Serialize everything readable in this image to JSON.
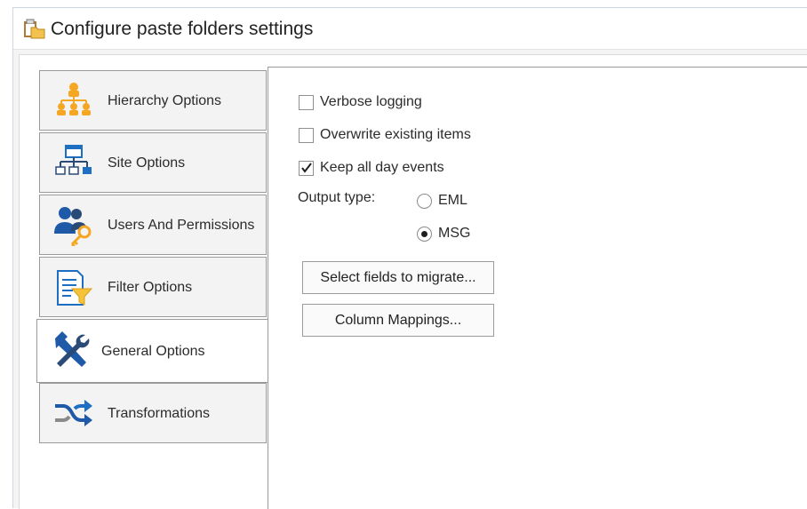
{
  "window": {
    "title": "Configure paste folders settings",
    "icon": "clipboard-folder-icon"
  },
  "tabs": [
    {
      "label": "Hierarchy Options",
      "icon": "hierarchy-icon"
    },
    {
      "label": "Site Options",
      "icon": "site-icon"
    },
    {
      "label": "Users And Permissions",
      "icon": "users-key-icon"
    },
    {
      "label": "Filter Options",
      "icon": "filter-icon"
    },
    {
      "label": "General Options",
      "icon": "tools-icon",
      "active": true
    },
    {
      "label": "Transformations",
      "icon": "shuffle-icon"
    }
  ],
  "general": {
    "verbose_logging": {
      "label": "Verbose logging",
      "checked": false
    },
    "overwrite_items": {
      "label": "Overwrite existing items",
      "checked": false
    },
    "keep_all_day": {
      "label": "Keep all day events",
      "checked": true
    },
    "output_type_label": "Output type:",
    "output_options": [
      {
        "label": "EML",
        "selected": false
      },
      {
        "label": "MSG",
        "selected": true
      }
    ],
    "select_fields_button": "Select fields to migrate...",
    "column_mappings_button": "Column Mappings..."
  },
  "colors": {
    "icon_orange": "#f5a623",
    "icon_blue": "#1e6fc2",
    "icon_dark": "#2a4a78"
  }
}
